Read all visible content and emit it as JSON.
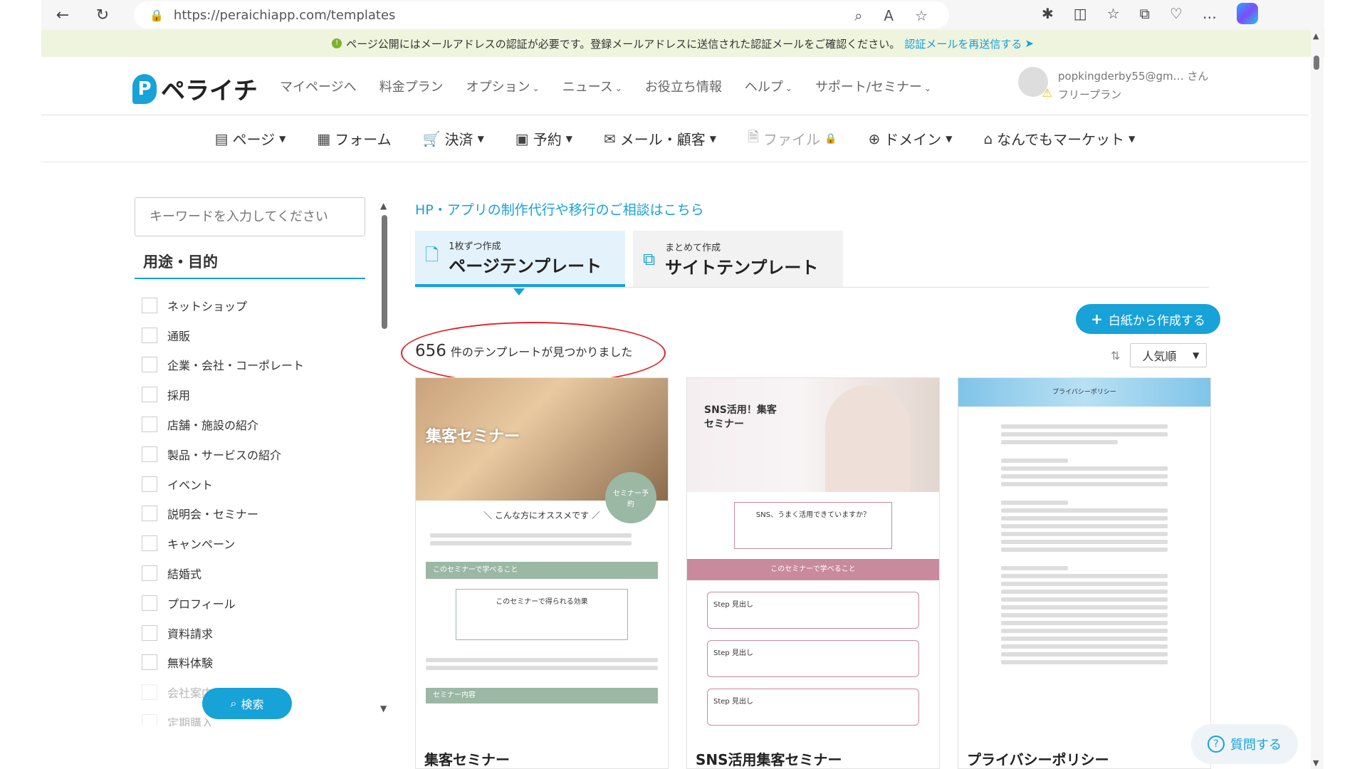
{
  "browser": {
    "url": "https://peraichiapp.com/templates"
  },
  "notice": {
    "icon": "!",
    "text": "ページ公開にはメールアドレスの認証が必要です。登録メールアドレスに送信された認証メールをご確認ください。",
    "link": "認証メールを再送信する"
  },
  "header": {
    "logo_text": "ペライチ",
    "logo_letter": "P",
    "nav": [
      "マイページへ",
      "料金プラン",
      "オプション",
      "ニュース",
      "お役立ち情報",
      "ヘルプ",
      "サポート/セミナー"
    ],
    "user_email": "popkingderby55@gm… さん",
    "plan": "フリープラン"
  },
  "tools": [
    {
      "label": "ページ",
      "icon": "page-icon"
    },
    {
      "label": "フォーム",
      "icon": "form-icon"
    },
    {
      "label": "決済",
      "icon": "cart-icon"
    },
    {
      "label": "予約",
      "icon": "calendar-icon"
    },
    {
      "label": "メール・顧客",
      "icon": "mail-icon"
    },
    {
      "label": "ファイル",
      "icon": "file-icon"
    },
    {
      "label": "ドメイン",
      "icon": "www-icon"
    },
    {
      "label": "なんでもマーケット",
      "icon": "market-icon"
    }
  ],
  "sidebar": {
    "search_placeholder": "キーワードを入力してください",
    "section_title": "用途・目的",
    "categories": [
      "ネットショップ",
      "通販",
      "企業・会社・コーポレート",
      "採用",
      "店舗・施設の紹介",
      "製品・サービスの紹介",
      "イベント",
      "説明会・セミナー",
      "キャンペーン",
      "結婚式",
      "プロフィール",
      "資料請求",
      "無料体験",
      "会社案内",
      "定期購入"
    ],
    "search_button": "検索"
  },
  "main": {
    "consult_link": "HP・アプリの制作代行や移行のご相談はこちら",
    "tabs": [
      {
        "small": "1枚ずつ作成",
        "big": "ページテンプレート"
      },
      {
        "small": "まとめて作成",
        "big": "サイトテンプレート"
      }
    ],
    "blank_button": "白紙から作成する",
    "count_number": "656",
    "count_text": "件のテンプレートが見つかりました",
    "sort_value": "人気順"
  },
  "cards": [
    {
      "title": "集客セミナー",
      "hero_text": "集客セミナー",
      "badge": "セミナー予約",
      "recommend": "＼ こんな方にオススメです ／",
      "section1": "このセミナーで学べること",
      "box_title": "このセミナーで得られる効果",
      "section2": "セミナー内容",
      "accent": "#9bb8a5"
    },
    {
      "title": "SNS活用集客セミナー",
      "hero_text": "SNS活用！集客セミナー",
      "box_title": "SNS、うまく活用できていますか？",
      "section1": "このセミナーで学べること",
      "step": "Step",
      "step_label": "見出し",
      "accent": "#c98a9d"
    },
    {
      "title": "プライバシーポリシー",
      "hero_text": "プライバシーポリシー",
      "accent": "#7fc4e8"
    }
  ],
  "help_button": "質問する"
}
